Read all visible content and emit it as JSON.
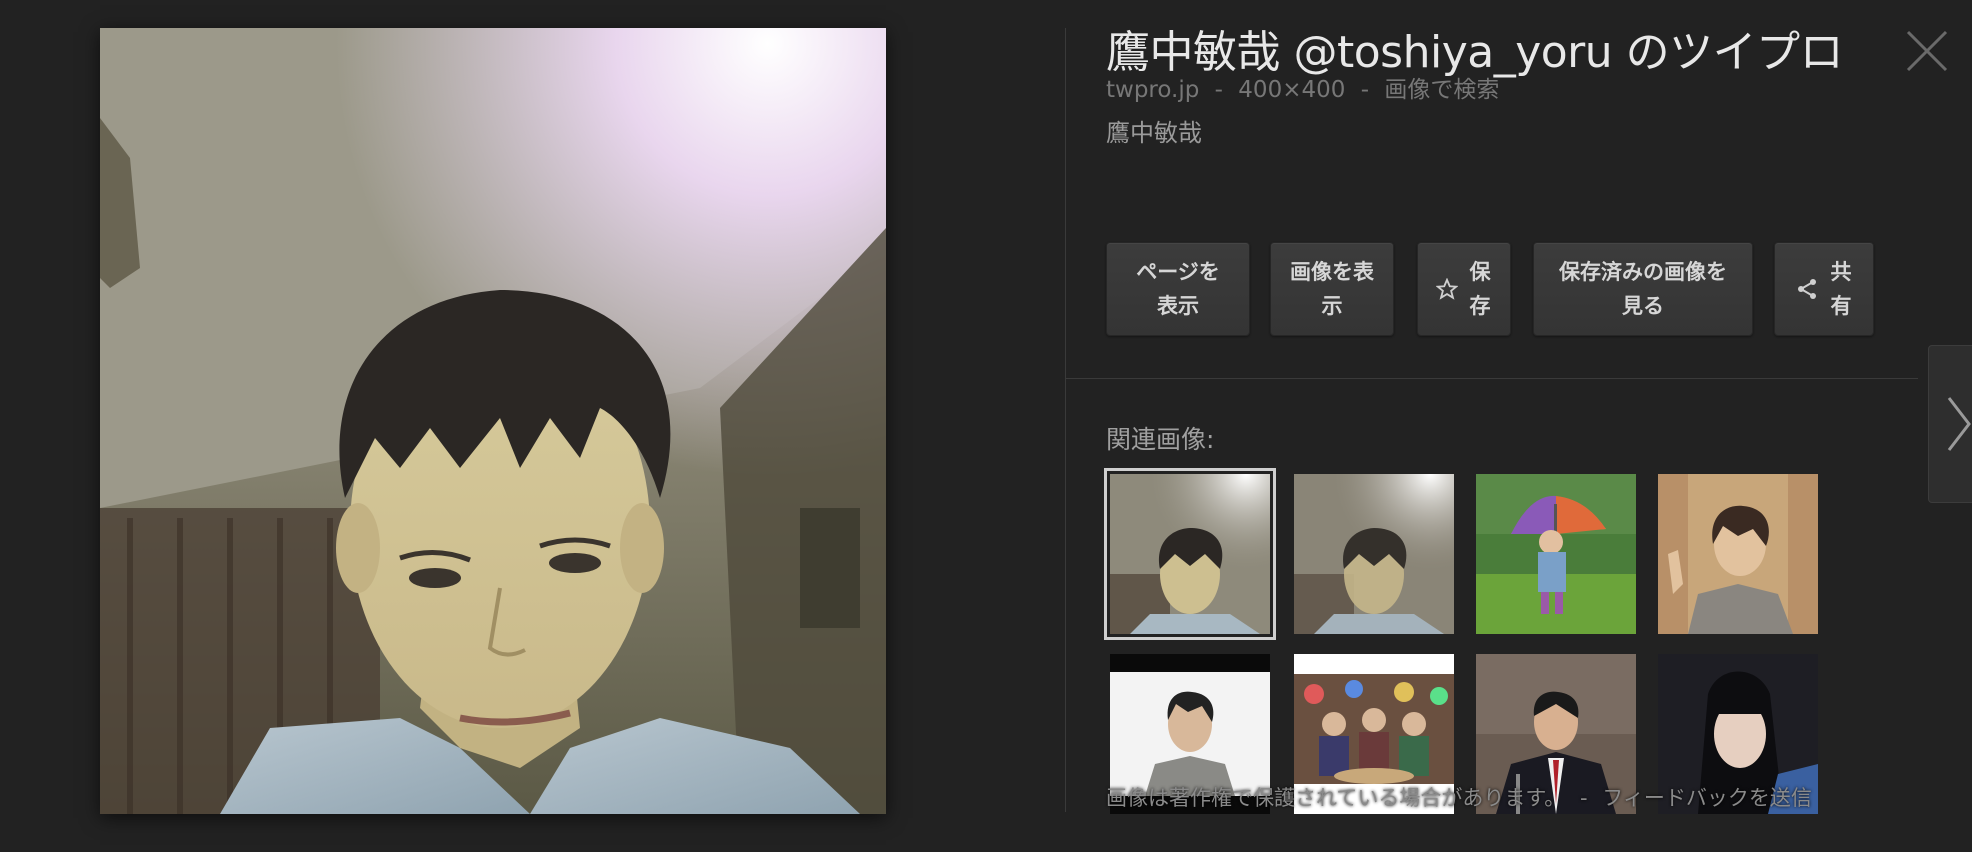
{
  "viewer": {
    "title": "鷹中敏哉 @toshiya_yoru のツイプロ",
    "meta": {
      "domain": "twpro.jp",
      "dimensions": "400×400",
      "search_by_image": "画像で検索",
      "separator": "-"
    },
    "description": "鷹中敏哉",
    "actions": [
      {
        "label": "ページを表示",
        "icon": ""
      },
      {
        "label": "画像を表示",
        "icon": ""
      },
      {
        "label": "保存",
        "icon": "star-icon"
      },
      {
        "label": "保存済みの画像を見る",
        "icon": ""
      },
      {
        "label": "共有",
        "icon": "share-icon"
      }
    ],
    "related_label": "関連画像:",
    "related_thumbs": [
      {
        "subject": "portrait-selfie",
        "selected": true
      },
      {
        "subject": "portrait-selfie-blurred",
        "selected": false
      },
      {
        "subject": "child-with-umbrella",
        "selected": false
      },
      {
        "subject": "man-waving",
        "selected": false
      },
      {
        "subject": "man-in-shirt",
        "selected": false
      },
      {
        "subject": "party-crowd",
        "selected": false
      },
      {
        "subject": "man-in-suit-speech",
        "selected": false
      },
      {
        "subject": "woman-portrait",
        "selected": false
      }
    ],
    "footer": {
      "copyright_notice": "画像は著作権で保護されている場合があります。",
      "separator": "-",
      "feedback_link": "フィードバックを送信"
    },
    "colors": {
      "background": "#222222",
      "button_bg": "#3a3a3a",
      "text_primary": "#e8e8e8",
      "text_muted": "#777777"
    }
  }
}
